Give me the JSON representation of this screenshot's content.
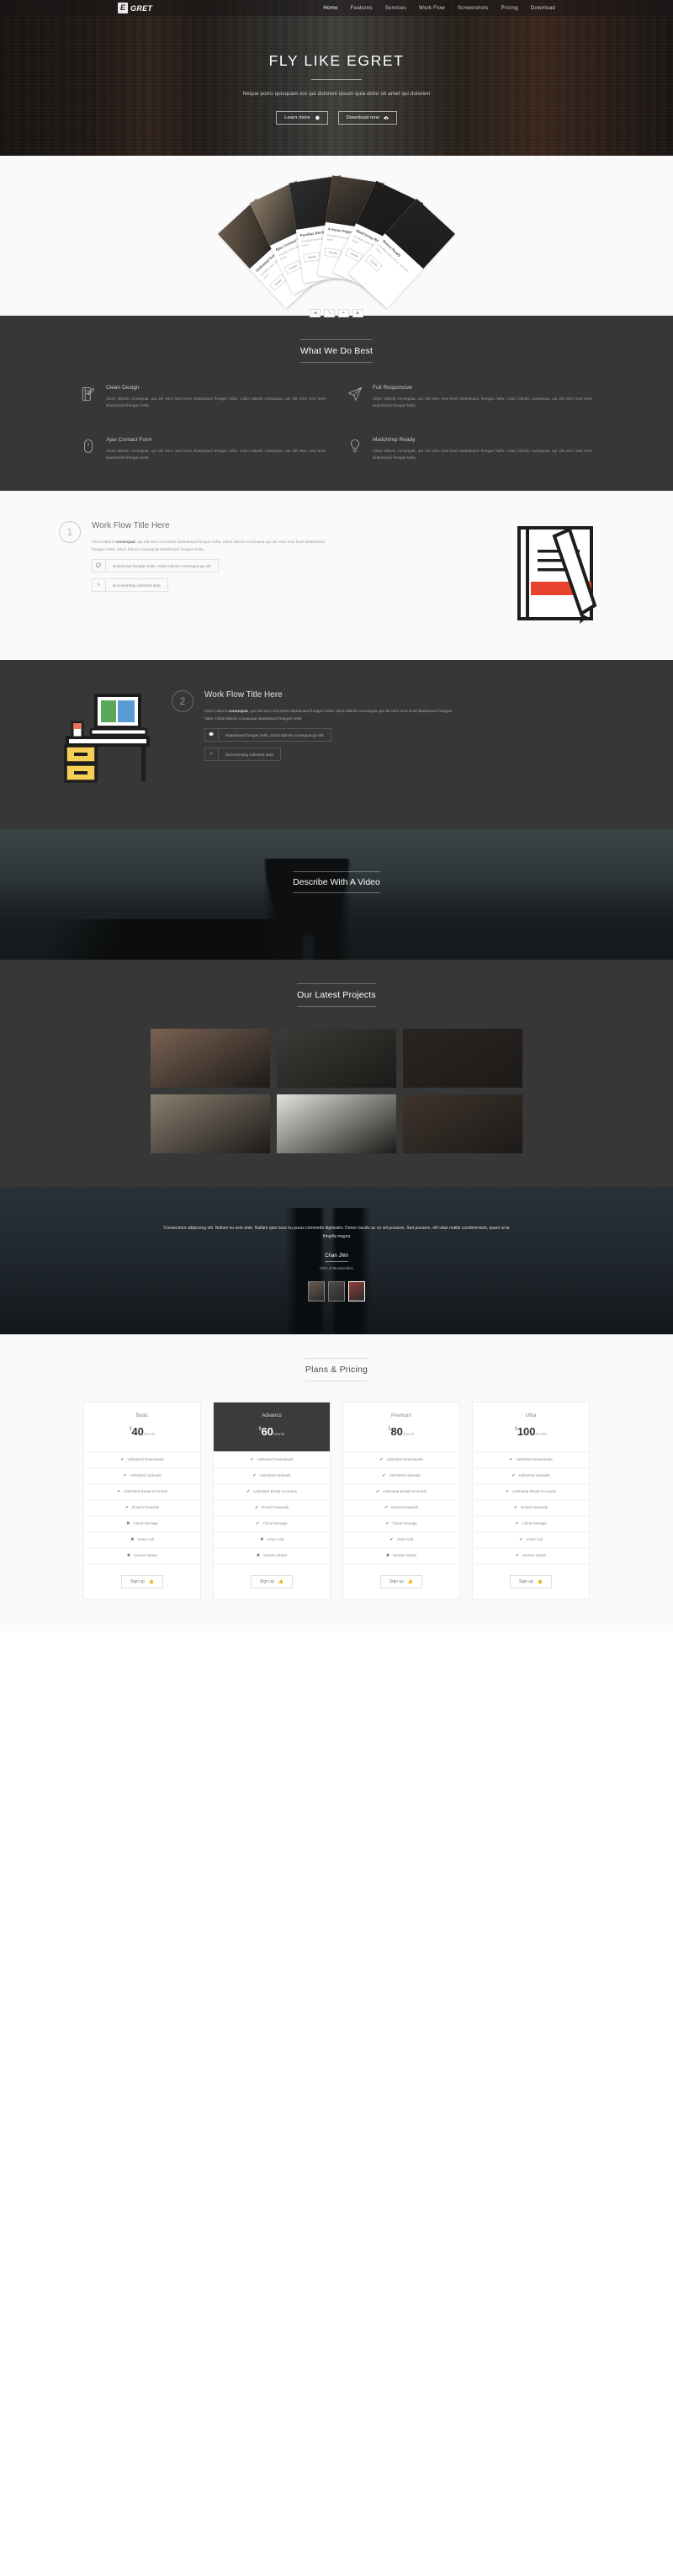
{
  "header": {
    "brand_badge": "E",
    "brand_text": "GRET",
    "nav": [
      {
        "label": "Home",
        "active": true
      },
      {
        "label": "Features",
        "active": false
      },
      {
        "label": "Services",
        "active": false
      },
      {
        "label": "Work Flow",
        "active": false
      },
      {
        "label": "Screenshots",
        "active": false
      },
      {
        "label": "Pricing",
        "active": false
      },
      {
        "label": "Download",
        "active": false
      }
    ]
  },
  "hero": {
    "title": "FLY LIKE EGRET",
    "subtitle": "Neque porro quisquam est qui dolorem ipsum quia dolor sit amet qui dolorem",
    "btn_primary": "Learn more",
    "btn_primary_icon": "gear-icon",
    "btn_secondary": "Download now",
    "btn_secondary_icon": "cloud-download-icon"
  },
  "slider": {
    "cards": [
      {
        "title": "Unlimited Google Fonts",
        "text": "Curabitur posu ipsum, sed elem maxir",
        "btn": "Details",
        "img": "#6d5a4a"
      },
      {
        "title": "Ajax Contact Form",
        "text": "Curabitur posu ipsum, sed elem maxir",
        "btn": "Details",
        "img": "#8a7a66"
      },
      {
        "title": "Parallax Background",
        "text": "Curabitur posu ipsum, sed elem maxir",
        "btn": "Details",
        "img": "#2e2e30"
      },
      {
        "title": "4 Home Pages",
        "text": "Curabitur posu ipsum, sed elem maxir",
        "btn": "Details",
        "img": "#4b4138"
      },
      {
        "title": "MailChimp Ready",
        "text": "Curabitur posu ipsum, sed elem maxir",
        "btn": "Details",
        "img": "#1f1d1c"
      },
      {
        "title": "Retina Ready",
        "text": "Curabitur posu ipsum, sed elem maxir",
        "btn": "Details",
        "img": "#262422"
      }
    ],
    "controls": [
      {
        "name": "slider-prev",
        "glyph": "◀"
      },
      {
        "name": "slider-expand",
        "glyph": "⤡"
      },
      {
        "name": "slider-edit",
        "glyph": "✒"
      },
      {
        "name": "slider-next",
        "glyph": "▶"
      }
    ]
  },
  "features": {
    "title": "What We Do Best",
    "items": [
      {
        "icon": "notebook-pen-icon",
        "title": "Clean Design",
        "text": "Cilum laboris consequat, qui elit retro next level skateboard freegan hella. Cilum laboris consequat, qui elit retro next level skateboard freegan hella."
      },
      {
        "icon": "paper-plane-icon",
        "title": "Full Responsive",
        "text": "Cilum laboris consequat, qui elit retro next level skateboard freegan hella. Cilum laboris consequat, qui elit retro next level skateboard freegan hella."
      },
      {
        "icon": "mouse-icon",
        "title": "Ajax Contact Form",
        "text": "Cilum laboris consequat, qui elit retro next level skateboard freegan hella. Cilum laboris consequat, qui elit retro next level skateboard freegan hella."
      },
      {
        "icon": "lightbulb-icon",
        "title": "Mailchimp Ready",
        "text": "Cilum laboris consequat, qui elit retro next level skateboard freegan hella. Cilum laboris consequat, qui elit retro next level skateboard freegan hella."
      }
    ]
  },
  "workflow": [
    {
      "number": "1",
      "title": "Work Flow Title Here",
      "lead": "Cilum laboris ",
      "bold": "consequat",
      "rest": ", qui elit retro next level skateboard freegan hella. Cilum laboris consequat qui elit retro next level skateboard freegan hella. Cilum laboris consequat skateboard freegan hella.",
      "pill1_icon": "chat-icon",
      "pill1": "skateboard freegan hella. Cilum laboris consequat qui elit",
      "pill2_icon": "pencil-square-icon",
      "pill2": "Documenting collected data"
    },
    {
      "number": "2",
      "title": "Work Flow Title Here",
      "lead": "Cilum laboris ",
      "bold": "consequat",
      "rest": ", qui elit retro next level skateboard freegan hella. Cilum laboris consequat qui elit retro next level skateboard freegan hella. Cilum laboris consequat skateboard freegan hella",
      "pill1_icon": "chat-icon",
      "pill1": "skateboard freegan hella. Cilum laboris consequat qui elit",
      "pill2_icon": "pencil-square-icon",
      "pill2": "Documenting collected data"
    }
  ],
  "video": {
    "title": "Describe With A Video"
  },
  "projects": {
    "title": "Our Latest Projects",
    "items": [
      {
        "name": "project-camera-hands",
        "color": "#7a6253"
      },
      {
        "name": "project-camera-flowers",
        "color": "#3a3c38"
      },
      {
        "name": "project-lens-dark",
        "color": "#2a2522"
      },
      {
        "name": "project-vintage-camera",
        "color": "#8a7f70"
      },
      {
        "name": "project-poster",
        "color": "#e4e2dd"
      },
      {
        "name": "project-dog",
        "color": "#3f342c"
      }
    ]
  },
  "testimonial": {
    "quote": "Consectetur adipiscing elit. Nullam eu sem ante. Nullam quis risus eu purus commodo dignissim. Donec iaculis ac ex vel posuere. Sed posuere, elit vitae mattis condimentum, quam urna fringilla magna",
    "name": "Chan Jhin",
    "role": "CEO of MuoNaTakio",
    "avatars": [
      {
        "name": "avatar-1",
        "selected": false,
        "color": "#6b5b50"
      },
      {
        "name": "avatar-2",
        "selected": false,
        "color": "#4a4a4c"
      },
      {
        "name": "avatar-3",
        "selected": true,
        "color": "#8f4038"
      }
    ]
  },
  "pricing": {
    "title": "Plans & Pricing",
    "currency": "$",
    "period": "/Month",
    "signup_label": "Sign up",
    "signup_icon": "thumbs-up-icon",
    "plans": [
      {
        "name": "Basic",
        "price": "40",
        "featured": false,
        "features": [
          {
            "label": "Unlimited Downloads",
            "included": true
          },
          {
            "label": "Unlimited Uploads",
            "included": true
          },
          {
            "label": "Unlimited Email Accounts",
            "included": true
          },
          {
            "label": "Email Forwards",
            "included": true
          },
          {
            "label": "Cloud Storage",
            "included": false
          },
          {
            "label": "Voice call",
            "included": false
          },
          {
            "label": "Screen Share",
            "included": false
          }
        ]
      },
      {
        "name": "Advanco",
        "price": "60",
        "featured": true,
        "features": [
          {
            "label": "Unlimited Downloads",
            "included": true
          },
          {
            "label": "Unlimited Uploads",
            "included": true
          },
          {
            "label": "Unlimited Email Accounts",
            "included": true
          },
          {
            "label": "Email Forwards",
            "included": true
          },
          {
            "label": "Cloud Storage",
            "included": true
          },
          {
            "label": "Voice call",
            "included": false
          },
          {
            "label": "Screen Share",
            "included": false
          }
        ]
      },
      {
        "name": "Premium",
        "price": "80",
        "featured": false,
        "features": [
          {
            "label": "Unlimited Downloads",
            "included": true
          },
          {
            "label": "Unlimited Uploads",
            "included": true
          },
          {
            "label": "Unlimited Email Accounts",
            "included": true
          },
          {
            "label": "Email Forwards",
            "included": true
          },
          {
            "label": "Cloud Storage",
            "included": true
          },
          {
            "label": "Voice call",
            "included": true
          },
          {
            "label": "Screen Share",
            "included": false
          }
        ]
      },
      {
        "name": "Ultra",
        "price": "100",
        "featured": false,
        "features": [
          {
            "label": "Unlimited Downloads",
            "included": true
          },
          {
            "label": "Unlimited Uploads",
            "included": true
          },
          {
            "label": "Unlimited Email Accounts",
            "included": true
          },
          {
            "label": "Email Forwards",
            "included": true
          },
          {
            "label": "Cloud Storage",
            "included": true
          },
          {
            "label": "Voice call",
            "included": true
          },
          {
            "label": "Screen Share",
            "included": true
          }
        ]
      }
    ]
  },
  "colors": {
    "dark_section": "#373737",
    "light_section": "#fafafa",
    "accent_red": "#e8432f",
    "featured_card": "#3b3b3b"
  }
}
